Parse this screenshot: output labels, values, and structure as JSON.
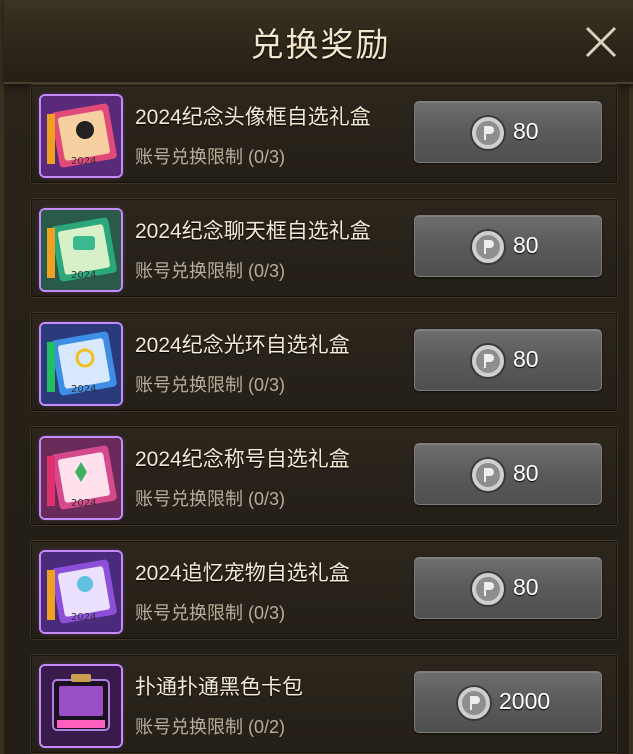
{
  "header": {
    "title": "兑换奖励"
  },
  "items": [
    {
      "name": "2024纪念头像框自选礼盒",
      "limit": "账号兑换限制 (0/3)",
      "price": "80",
      "icon": "avatar-frame-giftbox-icon",
      "accent": "#e24a7a"
    },
    {
      "name": "2024纪念聊天框自选礼盒",
      "limit": "账号兑换限制 (0/3)",
      "price": "80",
      "icon": "chat-frame-giftbox-icon",
      "accent": "#2aa87c"
    },
    {
      "name": "2024纪念光环自选礼盒",
      "limit": "账号兑换限制 (0/3)",
      "price": "80",
      "icon": "aura-giftbox-icon",
      "accent": "#3f8ee6"
    },
    {
      "name": "2024纪念称号自选礼盒",
      "limit": "账号兑换限制 (0/3)",
      "price": "80",
      "icon": "title-giftbox-icon",
      "accent": "#d44a8c"
    },
    {
      "name": "2024追忆宠物自选礼盒",
      "limit": "账号兑换限制 (0/3)",
      "price": "80",
      "icon": "pet-giftbox-icon",
      "accent": "#8b4fd8"
    },
    {
      "name": "扑通扑通黑色卡包",
      "limit": "账号兑换限制 (0/2)",
      "price": "2000",
      "icon": "black-card-pack-icon",
      "accent": "#9a4fc9"
    }
  ],
  "colors": {
    "background": "#221d15",
    "text": "#f3ead6",
    "subtext": "#b7ad9a",
    "button": "#5a5a5a"
  }
}
